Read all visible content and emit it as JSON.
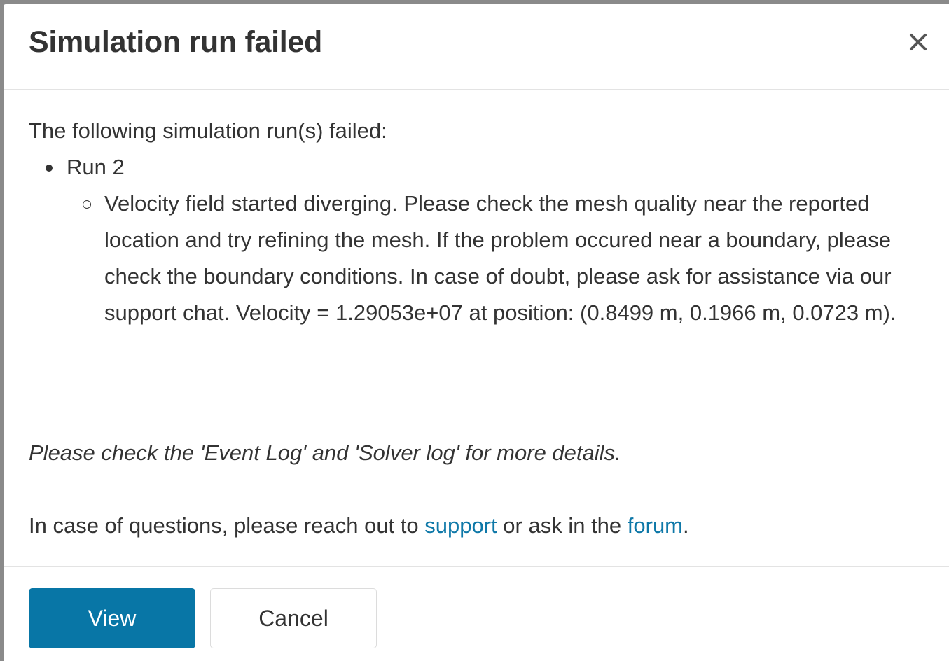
{
  "dialog": {
    "title": "Simulation run failed",
    "close_icon": "close-icon",
    "intro": "The following simulation run(s) failed:",
    "runs": [
      {
        "label": "Run 2",
        "errors": [
          "Velocity field started diverging. Please check the mesh quality near the reported location and try refining the mesh. If the problem occured near a boundary, please check the boundary conditions. In case of doubt, please ask for assistance via our support chat. Velocity = 1.29053e+07 at position: (0.8499 m, 0.1966 m, 0.0723 m)."
        ]
      }
    ],
    "hint": "Please check the 'Event Log' and 'Solver log' for more details.",
    "questions": {
      "prefix": "In case of questions, please reach out to ",
      "support_link": "support",
      "middle": " or ask in the ",
      "forum_link": "forum",
      "suffix": "."
    },
    "buttons": {
      "view": "View",
      "cancel": "Cancel"
    }
  },
  "colors": {
    "primary": "#0876a6",
    "link": "#0e78a8",
    "text": "#333333"
  }
}
